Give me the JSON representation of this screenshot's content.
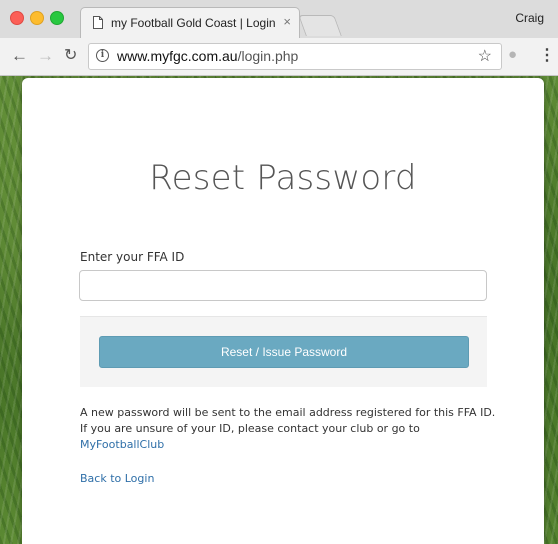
{
  "browser": {
    "tab_title": "my Football Gold Coast | Login",
    "tab_close": "×",
    "user_name": "Craig",
    "url_host": "www.myfgc.com.au",
    "url_path": "/login.php",
    "icons": {
      "back": "arrow-left-icon",
      "forward": "arrow-right-icon",
      "reload": "reload-icon",
      "info": "info-icon",
      "bookmark": "star-icon",
      "extension": "extension-icon",
      "menu": "menu-dots-icon"
    }
  },
  "page": {
    "heading": "Reset Password",
    "field_label": "Enter your FFA ID",
    "ffa_input_value": "",
    "button_label": "Reset / Issue Password",
    "info_line1": "A new password will be sent to the email address registered for this FFA ID.",
    "info_line2": "If you are unsure of your ID, please contact your club or go to",
    "info_link": "MyFootballClub",
    "back_link": "Back to Login",
    "colors": {
      "button": "#6aa9c1",
      "link": "#2f6fa8"
    }
  }
}
